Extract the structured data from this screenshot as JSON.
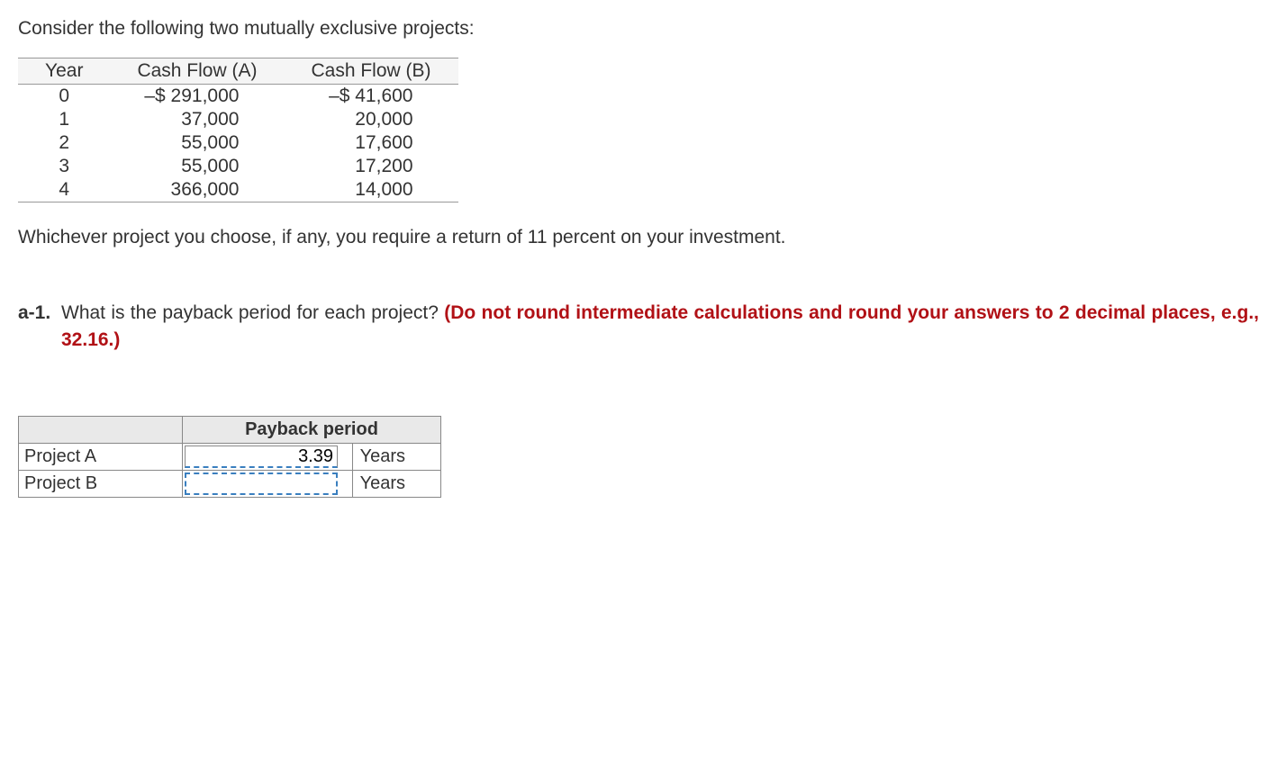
{
  "intro": "Consider the following two mutually exclusive projects:",
  "table_headers": {
    "year": "Year",
    "cfa": "Cash Flow (A)",
    "cfb": "Cash Flow (B)"
  },
  "rows": [
    {
      "year": "0",
      "cfa": "–$ 291,000",
      "cfb": "–$ 41,600"
    },
    {
      "year": "1",
      "cfa": "37,000",
      "cfb": "20,000"
    },
    {
      "year": "2",
      "cfa": "55,000",
      "cfb": "17,600"
    },
    {
      "year": "3",
      "cfa": "55,000",
      "cfb": "17,200"
    },
    {
      "year": "4",
      "cfa": "366,000",
      "cfb": "14,000"
    }
  ],
  "note": "Whichever project you choose, if any, you require a return of 11 percent on your investment.",
  "q_label": "a-1.",
  "q_text_plain": "What is the payback period for each project? ",
  "q_text_red": "(Do not round intermediate calculations and round your answers to 2 decimal places, e.g., 32.16.)",
  "answer_table": {
    "header": "Payback period",
    "rows": [
      {
        "label": "Project A",
        "value": "3.39",
        "unit": "Years"
      },
      {
        "label": "Project B",
        "value": "",
        "unit": "Years"
      }
    ]
  }
}
